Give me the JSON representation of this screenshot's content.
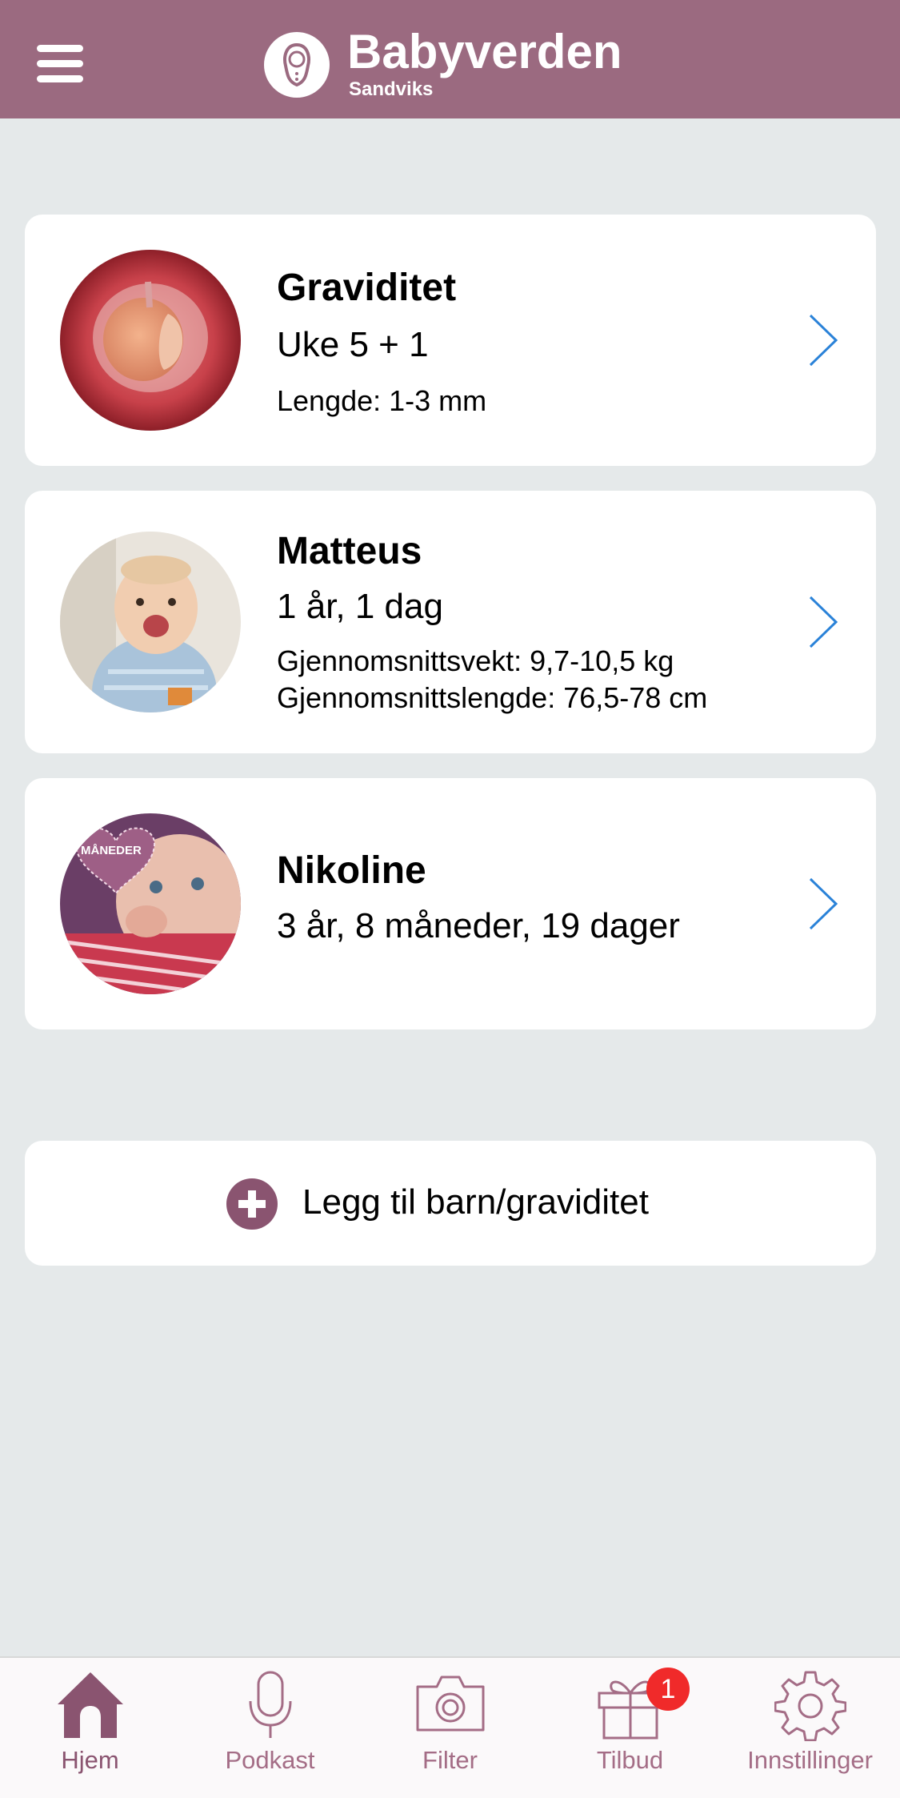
{
  "colors": {
    "header_bg": "#9b6a80",
    "page_bg": "#e5e9ea",
    "accent": "#8a5470",
    "chevron": "#2a82d8",
    "badge": "#f02a2a"
  },
  "header": {
    "title": "Babyverden",
    "subtitle": "Sandviks"
  },
  "cards": [
    {
      "title": "Graviditet",
      "subtitle": "Uke 5 + 1",
      "details": [
        "Lengde: 1-3 mm"
      ]
    },
    {
      "title": "Matteus",
      "subtitle": "1 år, 1 dag",
      "details": [
        "Gjennomsnittsvekt: 9,7-10,5 kg",
        "Gjennomsnittslengde: 76,5-78 cm"
      ]
    },
    {
      "title": "Nikoline",
      "subtitle": "3 år, 8 måneder, 19 dager",
      "details": [],
      "image_text": "MÅNEDER"
    }
  ],
  "add_button": {
    "label": "Legg til barn/graviditet"
  },
  "tabbar": {
    "items": [
      {
        "label": "Hjem",
        "icon": "house-icon",
        "active": true
      },
      {
        "label": "Podkast",
        "icon": "microphone-icon",
        "active": false
      },
      {
        "label": "Filter",
        "icon": "camera-icon",
        "active": false
      },
      {
        "label": "Tilbud",
        "icon": "gift-icon",
        "active": false,
        "badge": "1"
      },
      {
        "label": "Innstillinger",
        "icon": "gear-icon",
        "active": false
      }
    ]
  }
}
